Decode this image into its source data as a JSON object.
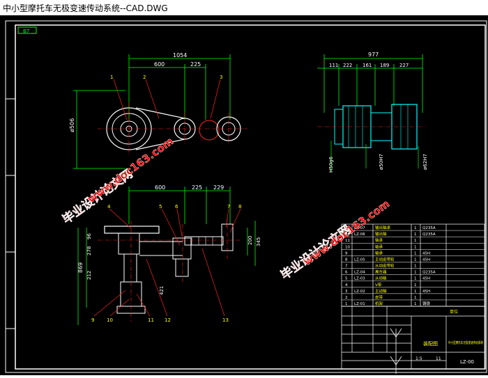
{
  "window": {
    "title": "中小型摩托车无极变速传动系统--CAD.DWG"
  },
  "drawing": {
    "tag": "B7",
    "top_view": {
      "overall_dim": "1054",
      "dim_a": "600",
      "dim_b": "225",
      "diameter": "ø506",
      "callouts": [
        "1",
        "2",
        "3"
      ]
    },
    "side_view": {
      "overall_dim": "977",
      "dims": [
        "111",
        "222",
        "161",
        "189",
        "227"
      ],
      "fits": [
        "H50g6",
        "ø50H7",
        "ø62H7"
      ]
    },
    "front_view": {
      "dim_a": "600",
      "dim_b": "225",
      "dim_c": "229",
      "dims_left": [
        "96",
        "278",
        "212",
        "869"
      ],
      "dims_right": [
        "200",
        "345"
      ],
      "dim_bottom": "421",
      "callouts_top": [
        "4",
        "5",
        "6",
        "7",
        "8"
      ],
      "callouts_bottom": [
        "9",
        "10",
        "11",
        "12",
        "13"
      ]
    },
    "watermarks": {
      "site": "www.doc163.com",
      "brand": "毕业设计论文网"
    },
    "parts_table": {
      "rows": [
        {
          "no": "13",
          "code": "LZ-07",
          "name": "输出轴承",
          "qty": "1",
          "mat": "Q235A"
        },
        {
          "no": "12",
          "code": "LZ-06",
          "name": "输出轴",
          "qty": "1",
          "mat": "Q235A"
        },
        {
          "no": "11",
          "code": "",
          "name": "轴承",
          "qty": "1",
          "mat": ""
        },
        {
          "no": "10",
          "code": "",
          "name": "轴承",
          "qty": "1",
          "mat": ""
        },
        {
          "no": "9",
          "code": "",
          "name": "轴承",
          "qty": "1",
          "mat": "45H"
        },
        {
          "no": "8",
          "code": "LZ-05",
          "name": "主动皮带轮",
          "qty": "1",
          "mat": "45H"
        },
        {
          "no": "7",
          "code": "",
          "name": "从动皮带轮",
          "qty": "1",
          "mat": ""
        },
        {
          "no": "6",
          "code": "LZ-04",
          "name": "离合器",
          "qty": "1",
          "mat": "Q235A"
        },
        {
          "no": "5",
          "code": "LZ-03",
          "name": "从动轴",
          "qty": "1",
          "mat": "45H"
        },
        {
          "no": "4",
          "code": "",
          "name": "V带",
          "qty": "1",
          "mat": ""
        },
        {
          "no": "3",
          "code": "LZ-02",
          "name": "主动轴",
          "qty": "1",
          "mat": "45H"
        },
        {
          "no": "2",
          "code": "",
          "name": "皮带",
          "qty": "1",
          "mat": ""
        },
        {
          "no": "1",
          "code": "LZ-01",
          "name": "机架",
          "qty": "1",
          "mat": "铸铁"
        }
      ],
      "header": {
        "no": "序号",
        "code": "代号",
        "name": "名称",
        "qty": "数量",
        "mat": "材料",
        "note": "备注"
      }
    },
    "title_block": {
      "name": "装配图",
      "project": "中小型摩托车无极变速传动系统",
      "drawing_no": "LZ-00",
      "scale": "1:5",
      "sheets": "11",
      "unit": "单位"
    }
  }
}
